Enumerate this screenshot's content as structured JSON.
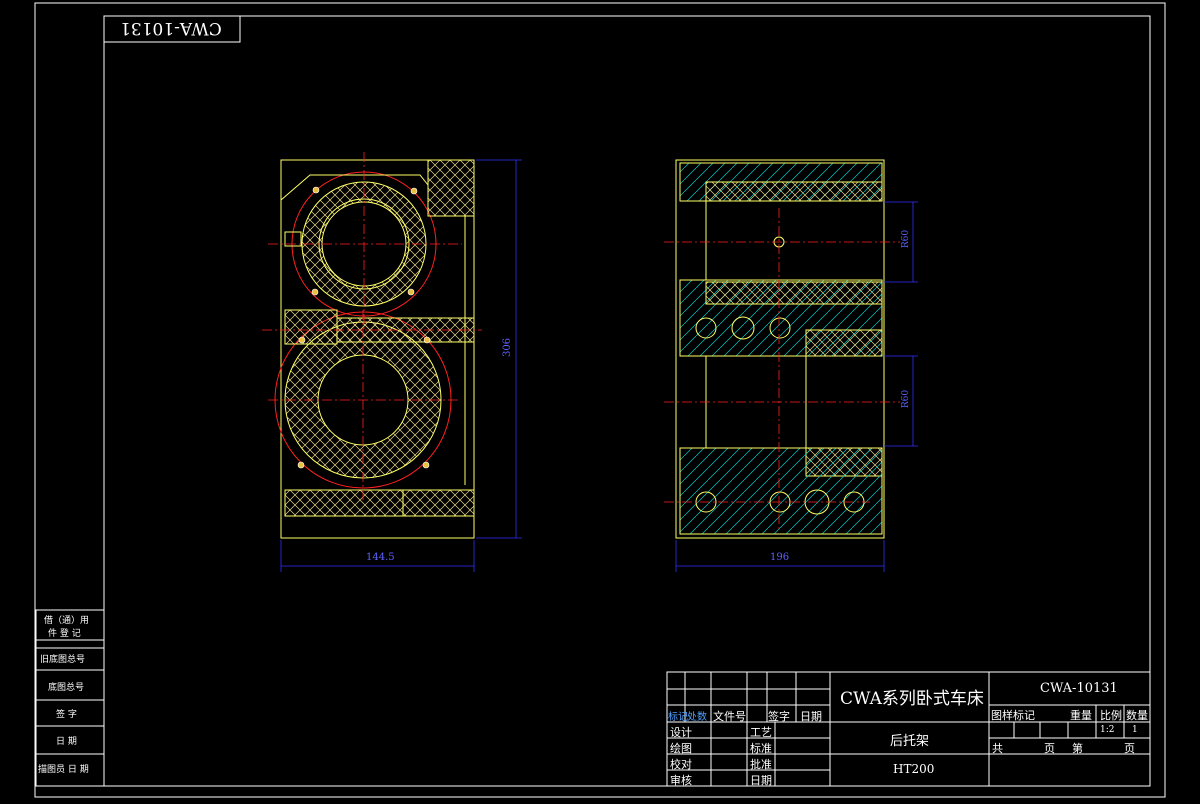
{
  "drawing": {
    "mirrored_code": "CWA-10131",
    "dims": {
      "left_width": "144.5",
      "left_height": "306",
      "right_width": "196",
      "right_upper": "R60",
      "right_lower": "R60"
    }
  },
  "side_table": {
    "rows": [
      "借（通）用",
      "件 登 记",
      "旧底图总号",
      "底图总号",
      "签 字",
      "日 期",
      "描图员 日 期"
    ]
  },
  "title_block": {
    "header_labels": [
      "标记",
      "处数",
      "文件号",
      "签字",
      "日期"
    ],
    "left_roles": [
      "设计",
      "绘图",
      "校对",
      "审核"
    ],
    "mid_roles": [
      "工艺",
      "标准",
      "批准",
      "日期"
    ],
    "series_title": "CWA系列卧式车床",
    "part_name": "后托架",
    "material": "HT200",
    "drawing_number": "CWA-10131",
    "attr_headers": [
      "图样标记",
      "重量",
      "比例",
      "数量"
    ],
    "scale": "1:2",
    "quantity": "1",
    "sheet_info": [
      "共",
      "页",
      "第",
      "页"
    ]
  },
  "colors": {
    "frame": "#ffffff",
    "outline": "#ffff66",
    "center_line": "#ff2020",
    "dimension": "#3030ff",
    "hatch_left": "#e8d88a",
    "hatch_right": "#00d0d0"
  }
}
